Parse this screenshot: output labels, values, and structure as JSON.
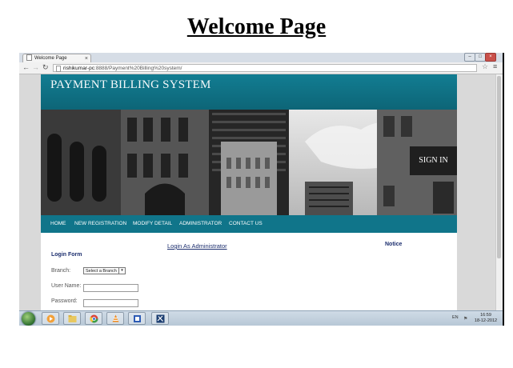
{
  "doc_title": "Welcome Page",
  "browser": {
    "tab_title": "Welcome Page",
    "url_host": "rishikumar-pc",
    "url_path": ":8888/Payment%20Billing%20system/"
  },
  "site": {
    "title": "PAYMENT BILLING SYSTEM",
    "sign_in": "SIGN IN",
    "nav": [
      "HOME",
      "NEW REGISTRATION",
      "MODIFY DETAIL",
      "ADMINISTRATOR",
      "CONTACT US"
    ],
    "admin_link": "Login As Administrator",
    "notice": "Notice",
    "login_form": {
      "title": "Login Form",
      "branch_label": "Branch:",
      "branch_value": "Select a Branch",
      "username_label": "User Name:",
      "password_label": "Password:"
    }
  },
  "taskbar": {
    "lang": "EN",
    "time": "16:59",
    "date": "18-12-2012"
  },
  "colors": {
    "header_teal": "#127d92",
    "nav_teal": "#10758a",
    "link_navy": "#1c2e6e"
  }
}
